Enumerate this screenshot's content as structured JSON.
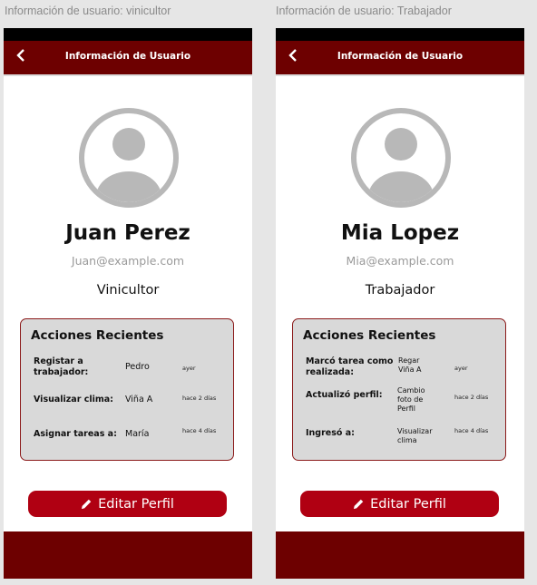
{
  "frames": [
    {
      "label": "Información de usuario: vinicultor",
      "header_title": "Información de Usuario",
      "user": {
        "name": "Juan Perez",
        "email": "Juan@example.com",
        "role": "Vinicultor"
      },
      "actions_title": "Acciones Recientes",
      "actions": [
        {
          "label": "Registar a trabajador:",
          "value": "Pedro",
          "time": "ayer"
        },
        {
          "label": "Visualizar clima:",
          "value": "Viña A",
          "time": "hace 2 días"
        },
        {
          "label": "Asignar tareas a:",
          "value": "María",
          "time": "hace 4 días"
        }
      ],
      "edit_label": "Editar Perfil"
    },
    {
      "label": "Información de usuario: Trabajador",
      "header_title": "Información de Usuario",
      "user": {
        "name": "Mia Lopez",
        "email": "Mia@example.com",
        "role": "Trabajador"
      },
      "actions_title": "Acciones Recientes",
      "actions": [
        {
          "label": "Marcó tarea como realizada:",
          "value": "Regar Viña A",
          "time": "ayer"
        },
        {
          "label": "Actualizó perfil:",
          "value": "Cambio foto de Perfil",
          "time": "hace 2 días"
        },
        {
          "label": "Ingresó a:",
          "value": "Visualizar clima",
          "time": "hace 4 días"
        }
      ],
      "edit_label": "Editar Perfil"
    }
  ],
  "colors": {
    "primary": "#6d0000",
    "button": "#b00012",
    "card": "#d9d9d9",
    "card_border": "#8b1a1a",
    "avatar": "#b8b8b8"
  },
  "icons": {
    "back": "chevron-left-icon",
    "avatar": "user-avatar-icon",
    "edit": "pencil-icon"
  }
}
